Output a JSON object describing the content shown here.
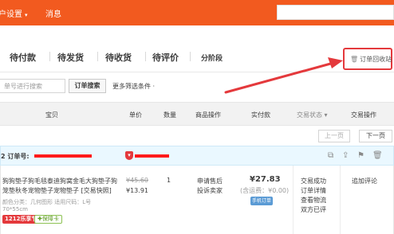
{
  "topbar": {
    "settings_label": "户设置",
    "caret": "▾",
    "messages_label": "消息"
  },
  "tabs": [
    {
      "label": "待付款"
    },
    {
      "label": "待发货"
    },
    {
      "label": "待收货"
    },
    {
      "label": "待评价"
    },
    {
      "label": "分阶段"
    }
  ],
  "recycle_bin": {
    "icon": "trash-icon",
    "label": "订单回收站"
  },
  "filters": {
    "search_placeholder": "单号进行搜索",
    "search_button": "订单搜索",
    "more_label": "更多筛选条件 ·"
  },
  "table_header": {
    "product": "宝贝",
    "unit_price": "单价",
    "quantity": "数量",
    "product_ops": "商品操作",
    "paid": "实付款",
    "status": "交易状态  ▾",
    "trade_ops": "交易操作"
  },
  "pager": {
    "prev": "上一页",
    "next": "下一页"
  },
  "order": {
    "order_no_label": "2  订单号:",
    "item": {
      "title_line1": "狗狗垫子狗毛毯泰迪狗窝金毛大狗垫子狗",
      "title_line2": "笼垫秋冬宠物垫子宠物垫子 [交易快照]",
      "sku_line1": "颜色分类：几何图形  适用尺码：L号",
      "sku_line2": "70*55cm",
      "promo_badge": "1212乐享节",
      "guarantee_badge": "保障卡",
      "original_price": "¥45.60",
      "price": "¥13.91",
      "quantity": "1",
      "op_line1": "申请售后",
      "op_line2": "投诉卖家"
    },
    "paid_amount": "¥27.83",
    "shipping_note": "(含运费：¥0.00)",
    "pay_badge": "手机订单",
    "status_lines": [
      "交易成功",
      "订单详情",
      "查看物流",
      "双方已评"
    ],
    "review_link": "追加评论"
  },
  "colors": {
    "brand_orange": "#f25a1f",
    "highlight_red": "#e4393c",
    "order_header_blue": "#eaf8ff"
  }
}
